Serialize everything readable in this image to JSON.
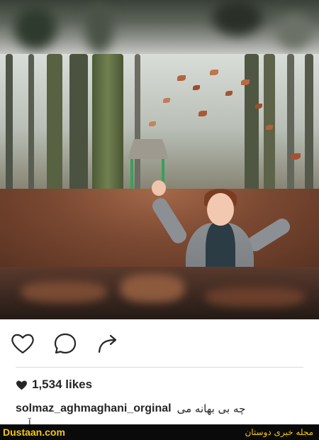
{
  "post": {
    "likes_count": "1,534 likes",
    "username": "solmaz_aghmaghani_orginal",
    "caption": "چه بی بهانه می",
    "caption_more": "آ"
  },
  "actions": {
    "like_icon": "heart-outline-icon",
    "comment_icon": "comment-bubble-icon",
    "share_icon": "share-arrow-icon"
  },
  "footer": {
    "site": "Dustaan.com",
    "magazine": "مجله خبری دوستان"
  },
  "colors": {
    "text": "#262626",
    "divider": "#dbdbdb",
    "footer_bg": "#0a0a0a",
    "footer_text": "#f7c90a"
  }
}
